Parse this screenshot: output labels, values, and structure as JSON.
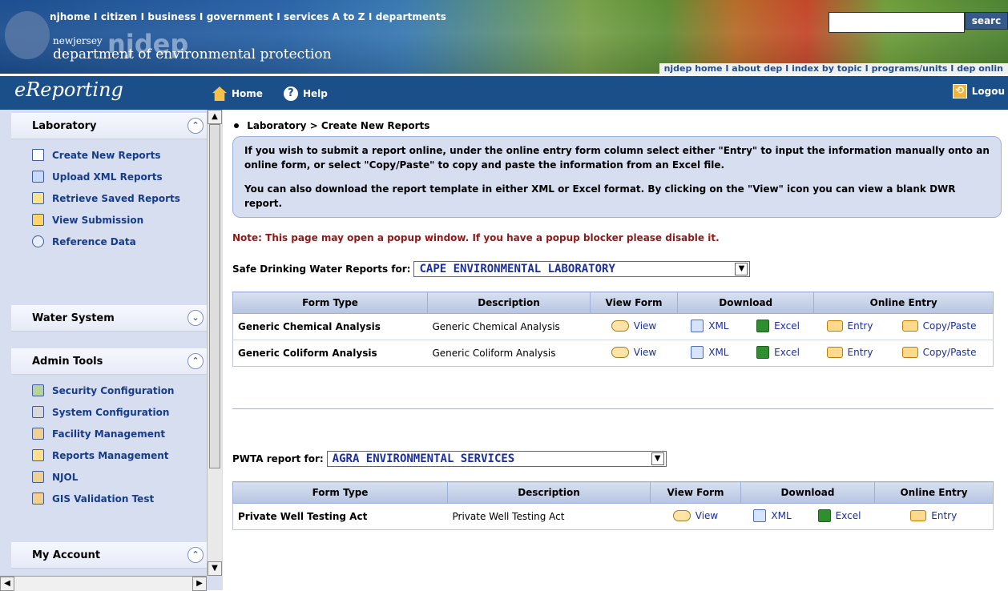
{
  "top_nav": {
    "items": [
      "njhome",
      "citizen",
      "business",
      "government",
      "services A to Z",
      "departments"
    ],
    "separator": "I"
  },
  "search": {
    "placeholder": "",
    "button_label": "searc"
  },
  "branding": {
    "njdep_prefix": "newjersey",
    "njdep_text": "njdep",
    "department": "department of environmental protection"
  },
  "sub_nav": {
    "items": [
      "njdep home",
      "about dep",
      "index by topic",
      "programs/units",
      "dep onlin"
    ],
    "separator": "I"
  },
  "app": {
    "title": "eReporting",
    "nav": {
      "home": "Home",
      "help": "Help",
      "logout": "Logou"
    }
  },
  "sidebar": {
    "sections": [
      {
        "title": "Laboratory",
        "expanded": true,
        "items": [
          {
            "label": "Create New Reports",
            "icon": "document-icon"
          },
          {
            "label": "Upload XML Reports",
            "icon": "xml-icon"
          },
          {
            "label": "Retrieve Saved Reports",
            "icon": "pen-icon"
          },
          {
            "label": "View Submission",
            "icon": "folder-icon"
          },
          {
            "label": "Reference Data",
            "icon": "magnifier-icon"
          }
        ]
      },
      {
        "title": "Water System",
        "expanded": false,
        "items": []
      },
      {
        "title": "Admin Tools",
        "expanded": true,
        "items": [
          {
            "label": "Security Configuration",
            "icon": "people-icon"
          },
          {
            "label": "System Configuration",
            "icon": "tools-icon"
          },
          {
            "label": "Facility Management",
            "icon": "hand-icon"
          },
          {
            "label": "Reports Management",
            "icon": "chart-icon"
          },
          {
            "label": "NJOL",
            "icon": "hand-icon"
          },
          {
            "label": "GIS Validation Test",
            "icon": "hand-icon"
          }
        ]
      },
      {
        "title": "My Account",
        "expanded": true,
        "items": []
      }
    ]
  },
  "main": {
    "breadcrumb": "Laboratory > Create New Reports",
    "info_paragraphs": [
      "If you wish to submit a report online, under the online entry form column select either \"Entry\" to input the information manually onto an online form, or select \"Copy/Paste\" to copy and paste the information from an Excel file.",
      "You can also download the report template in either XML or Excel format. By clicking on the \"View\" icon you can view a blank DWR report."
    ],
    "note": "Note: This page may open a popup window. If you have a popup blocker please disable it.",
    "sdw": {
      "label": "Safe Drinking Water Reports for:",
      "selected": "CAPE ENVIRONMENTAL LABORATORY",
      "headers": [
        "Form Type",
        "Description",
        "View Form",
        "Download",
        "Online Entry"
      ],
      "rows": [
        {
          "form_type": "Generic Chemical Analysis",
          "description": "Generic Chemical Analysis",
          "view": "View",
          "xml": "XML",
          "excel": "Excel",
          "entry": "Entry",
          "copy": "Copy/Paste"
        },
        {
          "form_type": "Generic Coliform Analysis",
          "description": "Generic Coliform Analysis",
          "view": "View",
          "xml": "XML",
          "excel": "Excel",
          "entry": "Entry",
          "copy": "Copy/Paste"
        }
      ]
    },
    "pwta": {
      "label": "PWTA report for:",
      "selected": "AGRA ENVIRONMENTAL SERVICES",
      "headers": [
        "Form Type",
        "Description",
        "View Form",
        "Download",
        "Online Entry"
      ],
      "rows": [
        {
          "form_type": "Private Well Testing Act",
          "description": "Private Well Testing Act",
          "view": "View",
          "xml": "XML",
          "excel": "Excel",
          "entry": "Entry"
        }
      ]
    }
  }
}
